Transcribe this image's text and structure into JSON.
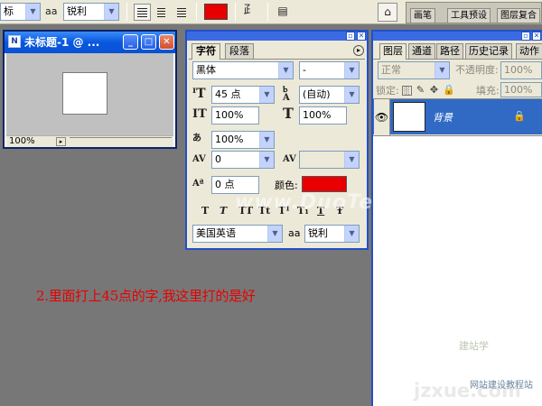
{
  "options_bar": {
    "font_style_partial": "标",
    "aa_label": "aa",
    "antialias": "锐利",
    "color": "#e80000",
    "well_tabs": [
      "画笔",
      "工具预设",
      "图层复合"
    ]
  },
  "document": {
    "title": "未标题-1 @ ...",
    "zoom": "100%",
    "buttons": {
      "minimize": "_",
      "maximize": "□",
      "close": "✕"
    }
  },
  "character_panel": {
    "tabs": [
      "字符",
      "段落"
    ],
    "font_family": "黑体",
    "font_style": "-",
    "size": "45 点",
    "leading": "(自动)",
    "vertical_scale": "100%",
    "horizontal_scale": "100%",
    "tracking_percent": "100%",
    "kerning": "0",
    "tracking_value": "",
    "baseline_shift": "0 点",
    "color_label": "颜色:",
    "color": "#e80000",
    "style_buttons": [
      "T",
      "T",
      "TT",
      "Tt",
      "T¹",
      "T₁",
      "T",
      "Ŧ"
    ],
    "language": "美国英语",
    "aa_label": "aa",
    "antialias": "锐利"
  },
  "layers_panel": {
    "tabs": [
      "图层",
      "通道",
      "路径",
      "历史记录",
      "动作"
    ],
    "blend_mode": "正常",
    "opacity_label": "不透明度:",
    "opacity": "100%",
    "lock_label": "锁定:",
    "fill_label": "填充:",
    "fill": "100%",
    "layer_name": "背景"
  },
  "caption": "2.里面打上45点的字,我这里打的是好",
  "watermarks": {
    "center": "www.DuoTe.com",
    "logo": "建站学",
    "logo_small": "建站学",
    "url": "jzxue.com",
    "url_sub": "网站建设教程站"
  }
}
